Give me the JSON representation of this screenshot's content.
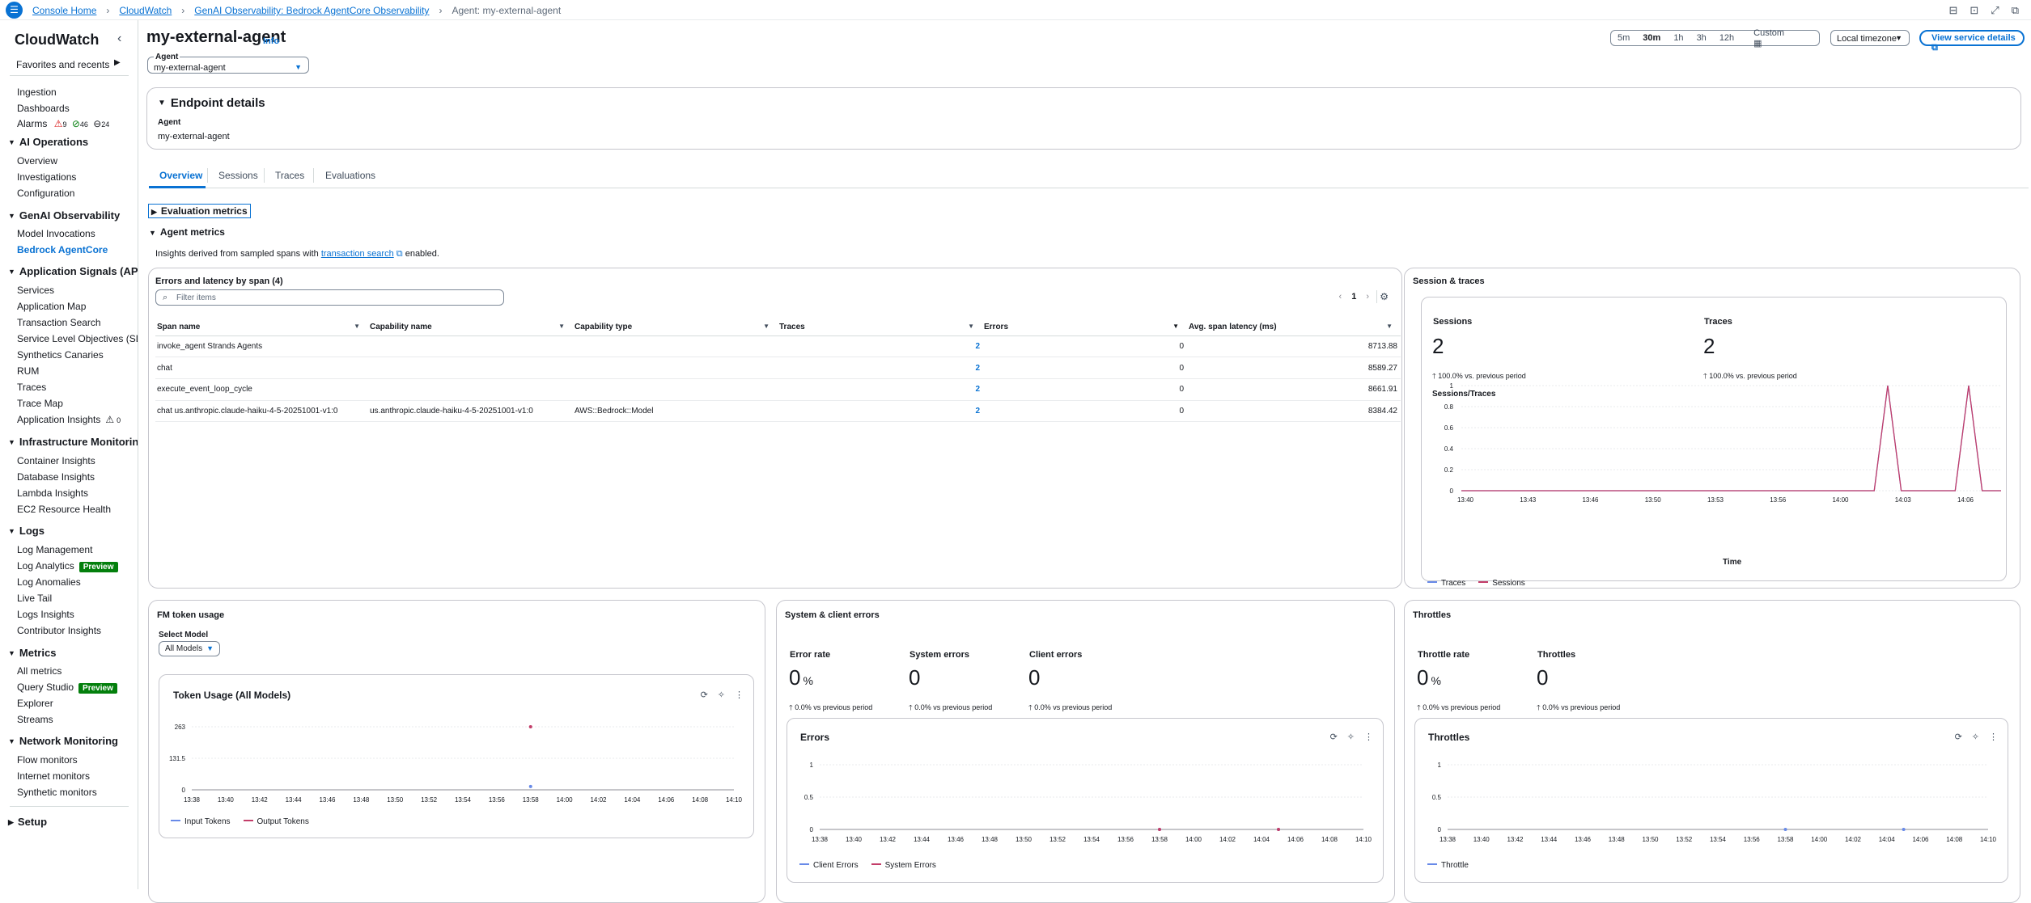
{
  "breadcrumbs": [
    "Console Home",
    "CloudWatch",
    "GenAI Observability: Bedrock AgentCore Observability",
    "Agent: my-external-agent"
  ],
  "sidebar": {
    "title": "CloudWatch",
    "favorites": "Favorites and recents",
    "top_items": [
      "Ingestion",
      "Dashboards"
    ],
    "alarms": {
      "label": "Alarms",
      "alarm": "9",
      "ok": "46",
      "insufficient": "24"
    },
    "sections": [
      {
        "title": "AI Operations",
        "items": [
          "Overview",
          "Investigations",
          "Configuration"
        ]
      },
      {
        "title": "GenAI Observability",
        "items": [
          "Model Invocations",
          "Bedrock AgentCore"
        ]
      },
      {
        "title": "Application Signals (APM)",
        "items": [
          "Services",
          "Application Map",
          "Transaction Search",
          "Service Level Objectives (SLO)",
          "Synthetics Canaries",
          "RUM",
          "Traces",
          "Trace Map",
          "Application Insights"
        ]
      },
      {
        "title": "Infrastructure Monitoring",
        "items": [
          "Container Insights",
          "Database Insights",
          "Lambda Insights",
          "EC2 Resource Health"
        ]
      },
      {
        "title": "Logs",
        "items": [
          "Log Management",
          "Log Analytics",
          "Log Anomalies",
          "Live Tail",
          "Logs Insights",
          "Contributor Insights"
        ]
      },
      {
        "title": "Metrics",
        "items": [
          "All metrics",
          "Query Studio",
          "Explorer",
          "Streams"
        ]
      },
      {
        "title": "Network Monitoring",
        "items": [
          "Flow monitors",
          "Internet monitors",
          "Synthetic monitors"
        ]
      }
    ],
    "app_insights_count": "0",
    "preview": "Preview",
    "setup": "Setup"
  },
  "header": {
    "title": "my-external-agent",
    "info": "Info",
    "agent_label": "Agent",
    "agent_value": "my-external-agent",
    "time_ranges": [
      "5m",
      "30m",
      "1h",
      "3h",
      "12h"
    ],
    "time_selected": "30m",
    "custom": "Custom",
    "timezone": "Local timezone",
    "view_service": "View service details"
  },
  "endpoint": {
    "title": "Endpoint details",
    "agent_label": "Agent",
    "agent_value": "my-external-agent"
  },
  "tabs": [
    "Overview",
    "Sessions",
    "Traces",
    "Evaluations"
  ],
  "eval_metrics": "Evaluation metrics",
  "agent_metrics": "Agent metrics",
  "insights": {
    "pre": "Insights derived from sampled spans with",
    "link": "transaction search",
    "post": "enabled."
  },
  "spans": {
    "title": "Errors and latency by span (4)",
    "filter_placeholder": "Filter items",
    "page": "1",
    "columns": [
      "Span name",
      "Capability name",
      "Capability type",
      "Traces",
      "Errors",
      "Avg. span latency (ms)"
    ],
    "rows": [
      [
        "invoke_agent Strands Agents",
        "",
        "",
        "2",
        "0",
        "8713.88"
      ],
      [
        "chat",
        "",
        "",
        "2",
        "0",
        "8589.27"
      ],
      [
        "execute_event_loop_cycle",
        "",
        "",
        "2",
        "0",
        "8661.91"
      ],
      [
        "chat us.anthropic.claude-haiku-4-5-20251001-v1:0",
        "us.anthropic.claude-haiku-4-5-20251001-v1:0",
        "AWS::Bedrock::Model",
        "2",
        "0",
        "8384.42"
      ]
    ]
  },
  "session_traces": {
    "title": "Session & traces",
    "sessions_label": "Sessions",
    "sessions_value": "2",
    "sessions_delta": "100.0% vs. previous period",
    "traces_label": "Traces",
    "traces_value": "2",
    "traces_delta": "100.0% vs. previous period",
    "chart_title": "Sessions/Traces",
    "xlabel": "Time",
    "legend": [
      "Traces",
      "Sessions"
    ]
  },
  "fm_tokens": {
    "title": "FM token usage",
    "select_label": "Select Model",
    "select_value": "All Models",
    "chart_title": "Token Usage (All Models)",
    "legend": [
      "Input Tokens",
      "Output Tokens"
    ]
  },
  "sys_errors": {
    "title": "System & client errors",
    "error_rate_label": "Error rate",
    "error_rate_value": "0",
    "error_rate_unit": "%",
    "error_rate_delta": "0.0% vs previous period",
    "system_label": "System errors",
    "system_value": "0",
    "system_delta": "0.0% vs previous period",
    "client_label": "Client errors",
    "client_value": "0",
    "client_delta": "0.0% vs previous period",
    "chart_title": "Errors",
    "legend": [
      "Client Errors",
      "System Errors"
    ]
  },
  "throttles": {
    "title": "Throttles",
    "rate_label": "Throttle rate",
    "rate_value": "0",
    "rate_unit": "%",
    "rate_delta": "0.0% vs previous period",
    "count_label": "Throttles",
    "count_value": "0",
    "count_delta": "0.0% vs previous period",
    "chart_title": "Throttles",
    "legend": [
      "Throttle"
    ]
  },
  "chart_data": [
    {
      "type": "line",
      "title": "Sessions/Traces",
      "xlabel": "Time",
      "x_ticks": [
        "13:40",
        "13:43",
        "13:46",
        "13:50",
        "13:53",
        "13:56",
        "14:00",
        "14:03",
        "14:06"
      ],
      "y_ticks": [
        "0",
        "0.2",
        "0.4",
        "0.6",
        "0.8",
        "1"
      ],
      "ylim": [
        0,
        1
      ],
      "series": [
        {
          "name": "Traces",
          "color": "#688ae8",
          "x": [
            0,
            0.765,
            0.79,
            0.815,
            0.915,
            0.94,
            0.965,
            1
          ],
          "values": [
            0,
            0,
            1,
            0,
            0,
            1,
            0,
            0
          ]
        },
        {
          "name": "Sessions",
          "color": "#c33d69",
          "x": [
            0,
            0.765,
            0.79,
            0.815,
            0.915,
            0.94,
            0.965,
            1
          ],
          "values": [
            0,
            0,
            1,
            0,
            0,
            1,
            0,
            0
          ]
        }
      ]
    },
    {
      "type": "scatter",
      "title": "Token Usage (All Models)",
      "x_ticks": [
        "13:38",
        "13:40",
        "13:42",
        "13:44",
        "13:46",
        "13:48",
        "13:50",
        "13:52",
        "13:54",
        "13:56",
        "13:58",
        "14:00",
        "14:02",
        "14:04",
        "14:06",
        "14:08",
        "14:10"
      ],
      "y_ticks": [
        "0",
        "131.5",
        "263"
      ],
      "ylim": [
        0,
        263
      ],
      "series": [
        {
          "name": "Input Tokens",
          "color": "#688ae8",
          "x": [
            "13:58"
          ],
          "values": [
            14
          ]
        },
        {
          "name": "Output Tokens",
          "color": "#c33d69",
          "x": [
            "13:58"
          ],
          "values": [
            263
          ]
        }
      ]
    },
    {
      "type": "scatter",
      "title": "Errors",
      "x_ticks": [
        "13:38",
        "13:40",
        "13:42",
        "13:44",
        "13:46",
        "13:48",
        "13:50",
        "13:52",
        "13:54",
        "13:56",
        "13:58",
        "14:00",
        "14:02",
        "14:04",
        "14:06",
        "14:08",
        "14:10"
      ],
      "y_ticks": [
        "0",
        "0.5",
        "1"
      ],
      "ylim": [
        0,
        1
      ],
      "series": [
        {
          "name": "Client Errors",
          "color": "#688ae8",
          "x": [
            "13:58",
            "14:05"
          ],
          "values": [
            0,
            0
          ]
        },
        {
          "name": "System Errors",
          "color": "#c33d69",
          "x": [
            "13:58",
            "14:05"
          ],
          "values": [
            0,
            0
          ]
        }
      ]
    },
    {
      "type": "scatter",
      "title": "Throttles",
      "x_ticks": [
        "13:38",
        "13:40",
        "13:42",
        "13:44",
        "13:46",
        "13:48",
        "13:50",
        "13:52",
        "13:54",
        "13:56",
        "13:58",
        "14:00",
        "14:02",
        "14:04",
        "14:06",
        "14:08",
        "14:10"
      ],
      "y_ticks": [
        "0",
        "0.5",
        "1"
      ],
      "ylim": [
        0,
        1
      ],
      "series": [
        {
          "name": "Throttle",
          "color": "#688ae8",
          "x": [
            "13:58",
            "14:05"
          ],
          "values": [
            0,
            0
          ]
        }
      ]
    }
  ]
}
